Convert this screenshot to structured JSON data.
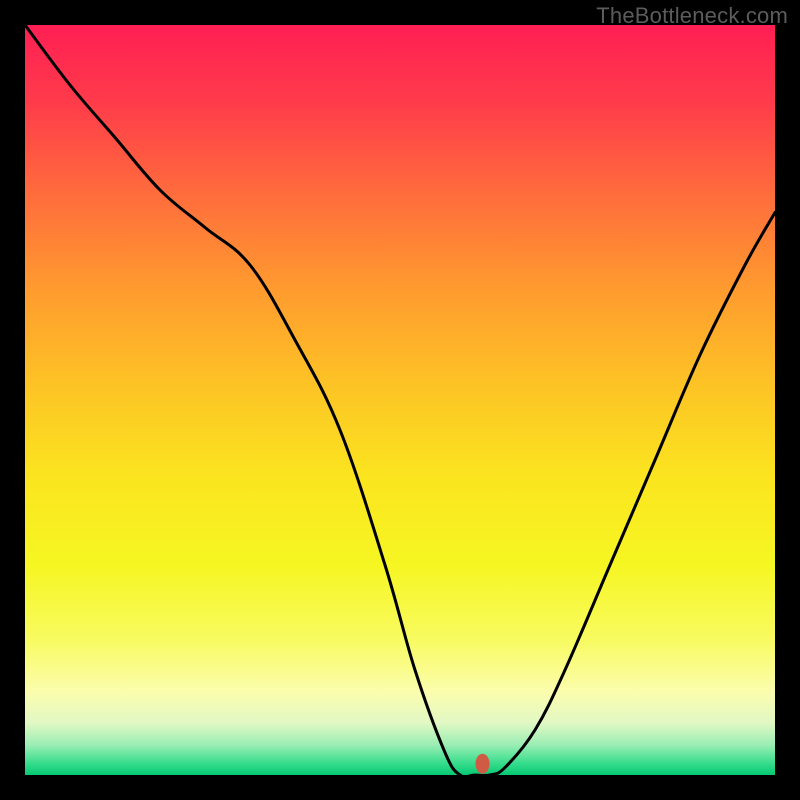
{
  "watermark": "TheBottleneck.com",
  "chart_data": {
    "type": "line",
    "title": "",
    "xlabel": "",
    "ylabel": "",
    "xlim": [
      0,
      100
    ],
    "ylim": [
      0,
      100
    ],
    "grid": false,
    "series": [
      {
        "name": "curve",
        "color": "#000000",
        "x": [
          0,
          6,
          12,
          18,
          24,
          30,
          36,
          42,
          48,
          52,
          56,
          58,
          60,
          62,
          64,
          68,
          72,
          78,
          84,
          90,
          96,
          100
        ],
        "y": [
          100,
          92,
          85,
          78,
          73,
          68,
          58,
          46,
          28,
          14,
          3,
          0,
          0,
          0,
          1,
          6,
          14,
          28,
          42,
          56,
          68,
          75
        ]
      }
    ],
    "marker": {
      "x": 61,
      "y": 1.5,
      "color": "#cf5b44",
      "rx": 7,
      "ry": 10
    },
    "background_gradient": {
      "stops": [
        {
          "offset": 0.0,
          "color": "#ff1f54"
        },
        {
          "offset": 0.1,
          "color": "#ff3a4b"
        },
        {
          "offset": 0.22,
          "color": "#ff6a3d"
        },
        {
          "offset": 0.35,
          "color": "#ff9a2f"
        },
        {
          "offset": 0.48,
          "color": "#fdc325"
        },
        {
          "offset": 0.6,
          "color": "#fbe41f"
        },
        {
          "offset": 0.72,
          "color": "#f6f622"
        },
        {
          "offset": 0.82,
          "color": "#f8fb61"
        },
        {
          "offset": 0.89,
          "color": "#fbfdae"
        },
        {
          "offset": 0.93,
          "color": "#e2f8c4"
        },
        {
          "offset": 0.96,
          "color": "#9aeeb4"
        },
        {
          "offset": 0.985,
          "color": "#34dc8b"
        },
        {
          "offset": 1.0,
          "color": "#06c873"
        }
      ]
    }
  }
}
